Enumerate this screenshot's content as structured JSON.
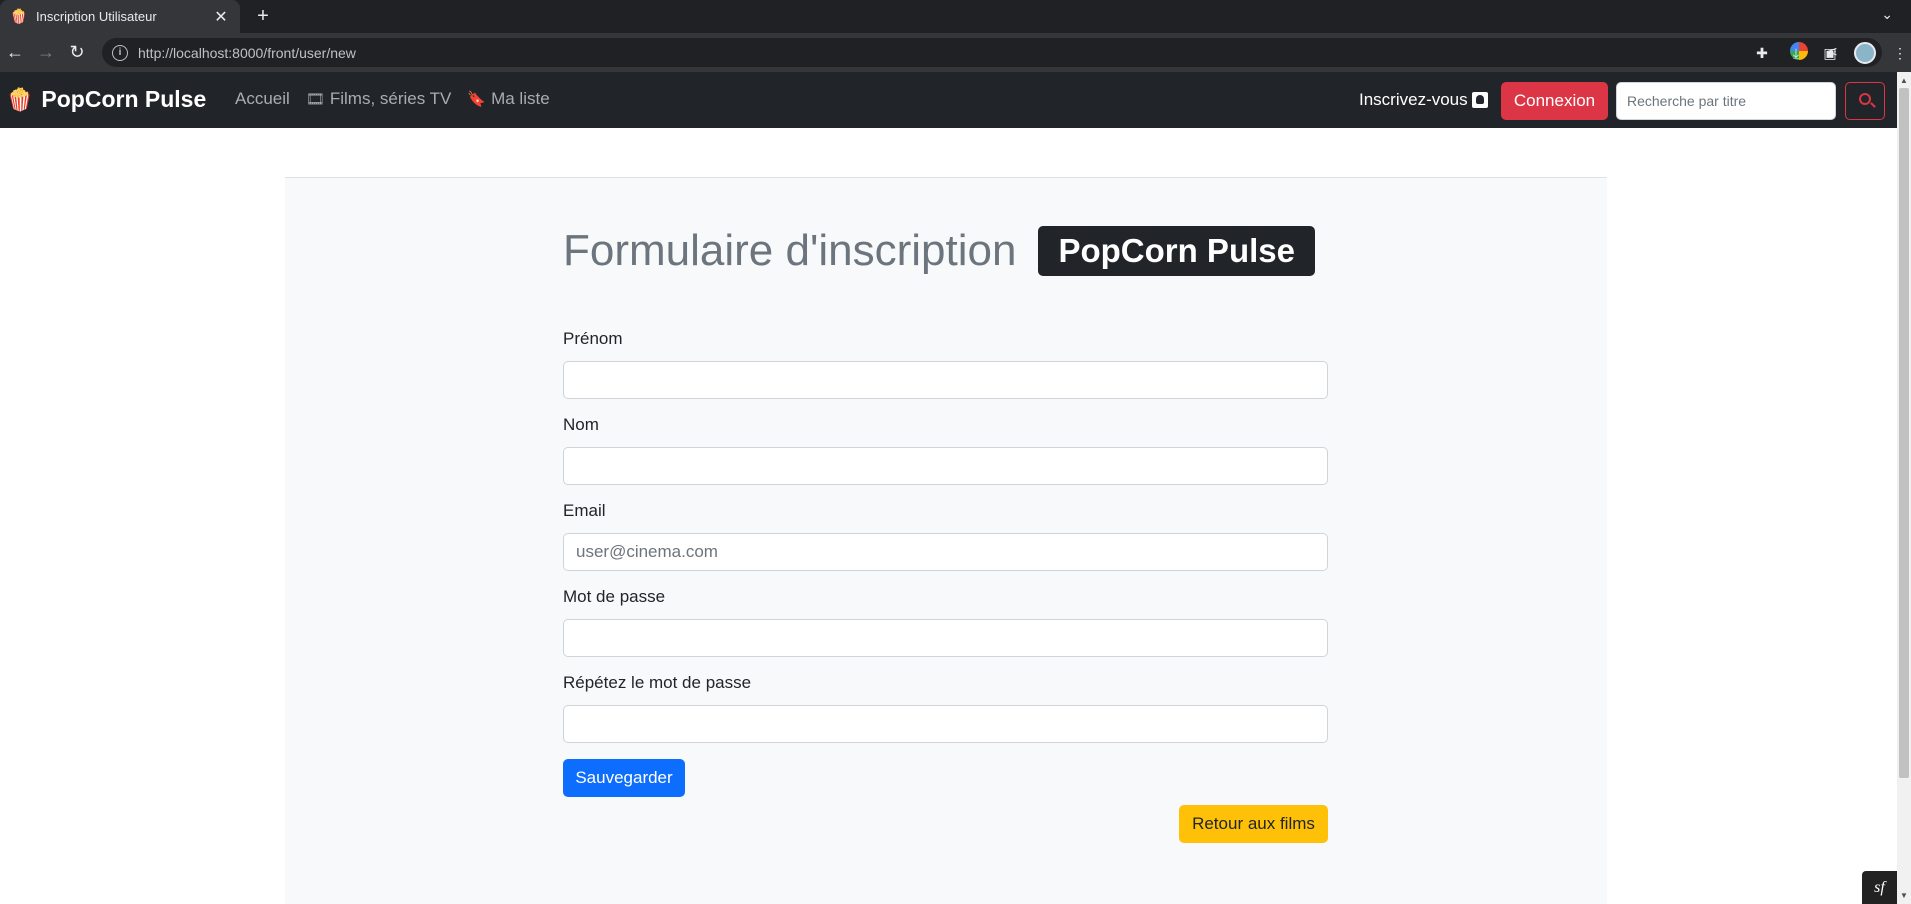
{
  "browser": {
    "tab_title": "Inscription Utilisateur",
    "tab_favicon": "🍿",
    "url": "http://localhost:8000/front/user/new"
  },
  "navbar": {
    "brand_icon": "🍿",
    "brand": "PopCorn Pulse",
    "links": [
      {
        "label": "Accueil",
        "icon": ""
      },
      {
        "label": "Films, séries TV",
        "icon": "film-icon"
      },
      {
        "label": "Ma liste",
        "icon": "bookmark-icon"
      }
    ],
    "signup_label": "Inscrivez-vous",
    "login_label": "Connexion",
    "search_placeholder": "Recherche par titre"
  },
  "form": {
    "heading": "Formulaire d'inscription",
    "badge": "PopCorn Pulse",
    "fields": [
      {
        "label": "Prénom",
        "value": "",
        "placeholder": ""
      },
      {
        "label": "Nom",
        "value": "",
        "placeholder": ""
      },
      {
        "label": "Email",
        "value": "",
        "placeholder": "user@cinema.com"
      },
      {
        "label": "Mot de passe",
        "value": "",
        "placeholder": ""
      },
      {
        "label": "Répétez le mot de passe",
        "value": "",
        "placeholder": ""
      }
    ],
    "save_label": "Sauvegarder",
    "back_label": "Retour aux films"
  },
  "colors": {
    "navbar_bg": "#212529",
    "login_btn": "#dc3545",
    "save_btn": "#0d6efd",
    "back_btn": "#ffc107"
  }
}
